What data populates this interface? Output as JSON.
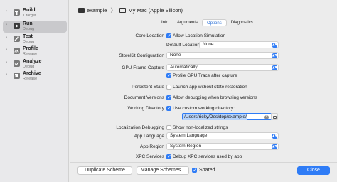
{
  "sidebar": {
    "items": [
      {
        "title": "Build",
        "subtitle": "1 target",
        "icon": "hammer-icon",
        "color": "#6b6b6b",
        "active": false
      },
      {
        "title": "Run",
        "subtitle": "Debug",
        "icon": "play-icon",
        "color": "#3a3a3a",
        "active": true
      },
      {
        "title": "Test",
        "subtitle": "Debug",
        "icon": "wrench-icon",
        "color": "#6b6b6b",
        "active": false
      },
      {
        "title": "Profile",
        "subtitle": "Release",
        "icon": "gauge-icon",
        "color": "#6b6b6b",
        "active": false
      },
      {
        "title": "Analyze",
        "subtitle": "Debug",
        "icon": "analyze-icon",
        "color": "#6b6b6b",
        "active": false
      },
      {
        "title": "Archive",
        "subtitle": "Release",
        "icon": "archive-icon",
        "color": "#6b6b6b",
        "active": false
      }
    ]
  },
  "header": {
    "scheme": "example",
    "separator": "〉",
    "destination": "My Mac (Apple Silicon)"
  },
  "tabs": [
    {
      "label": "Info",
      "selected": false
    },
    {
      "label": "Arguments",
      "selected": false
    },
    {
      "label": "Options",
      "selected": true
    },
    {
      "label": "Diagnostics",
      "selected": false
    }
  ],
  "options": {
    "core_location": {
      "label": "Core Location",
      "checkbox": "Allow Location Simulation",
      "checked": true
    },
    "default_location": {
      "label": "Default Location",
      "value": "None"
    },
    "storekit": {
      "label": "StoreKit Configuration",
      "value": "None"
    },
    "gpu_frame_capture": {
      "label": "GPU Frame Capture",
      "value": "Automatically"
    },
    "profile_gpu": {
      "checkbox": "Profile GPU Trace after capture",
      "checked": true
    },
    "persistent_state": {
      "label": "Persistent State",
      "checkbox": "Launch app without state restoration",
      "checked": false
    },
    "document_versions": {
      "label": "Document Versions",
      "checkbox": "Allow debugging when browsing versions",
      "checked": true
    },
    "working_directory": {
      "label": "Working Directory",
      "checkbox": "Use custom working directory:",
      "checked": true,
      "path": "/Users/ricky/Desktop/example/"
    },
    "localization_debugging": {
      "label": "Localization Debugging",
      "checkbox": "Show non-localized strings",
      "checked": false
    },
    "app_language": {
      "label": "App Language",
      "value": "System Language"
    },
    "app_region": {
      "label": "App Region",
      "value": "System Region"
    },
    "xpc_services": {
      "label": "XPC Services",
      "checkbox": "Debug XPC services used by app",
      "checked": true
    }
  },
  "footer": {
    "duplicate_label": "Duplicate Scheme",
    "manage_label": "Manage Schemes...",
    "shared_label": "Shared",
    "shared_checked": true,
    "close_label": "Close"
  },
  "colors": {
    "accent": "#2f7cf6",
    "selection": "#b8d4fb"
  }
}
